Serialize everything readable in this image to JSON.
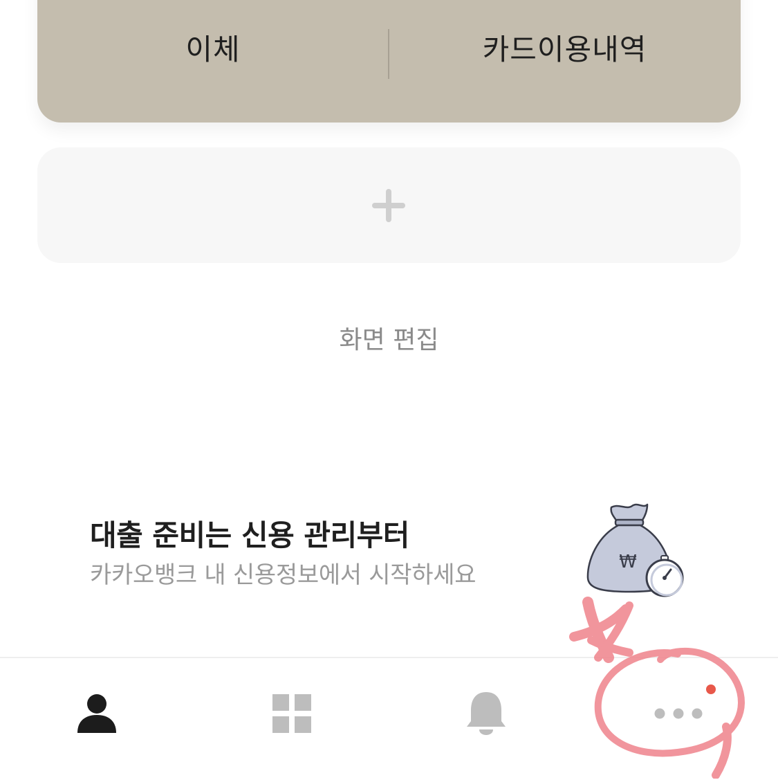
{
  "account_card": {
    "transfer_label": "이체",
    "card_history_label": "카드이용내역",
    "background_color": "#c4bdae"
  },
  "add_widget": {
    "icon": "plus-icon"
  },
  "screen_edit_label": "화면 편집",
  "promo": {
    "title": "대출 준비는 신용 관리부터",
    "subtitle": "카카오뱅크 내 신용정보에서 시작하세요",
    "illustration": "money-bag-stopwatch-icon",
    "currency_symbol": "₩"
  },
  "bottom_nav": {
    "items": [
      {
        "icon": "person-icon",
        "active": true
      },
      {
        "icon": "grid-icon",
        "active": false
      },
      {
        "icon": "bell-icon",
        "active": false
      },
      {
        "icon": "more-dots-icon",
        "active": false,
        "has_badge": true
      }
    ],
    "badge_color": "#e8584a"
  },
  "annotation": {
    "mark": "hand-drawn red x and circle around more button",
    "color": "#f08a92"
  }
}
